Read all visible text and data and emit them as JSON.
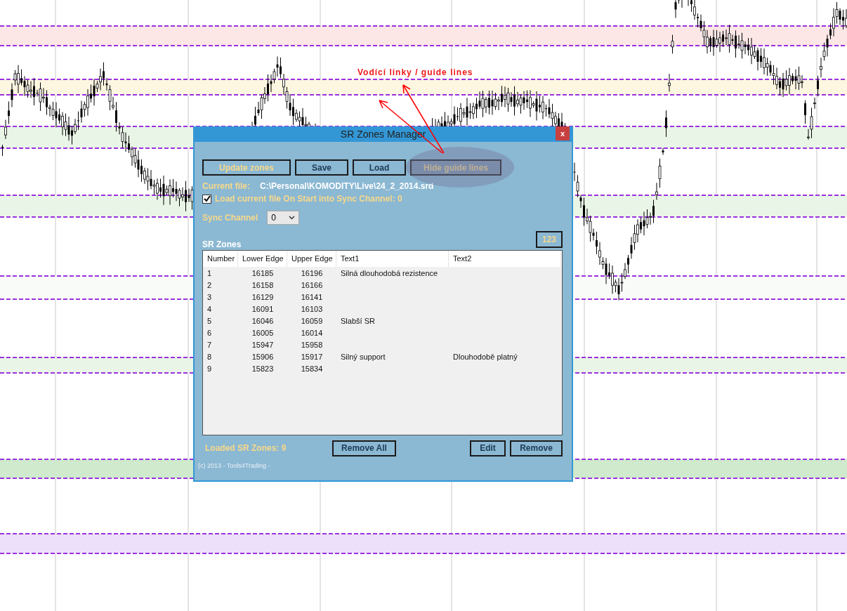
{
  "chart": {
    "annotation": "Vodící linky / guide lines"
  },
  "dialog": {
    "title": "SR Zones Manager",
    "close_glyph": "x",
    "buttons": [
      {
        "label": "Update zones",
        "kind": "accent"
      },
      {
        "label": "Save",
        "kind": "plain"
      },
      {
        "label": "Load",
        "kind": "plain"
      },
      {
        "label": "Hide guide lines",
        "kind": "accent"
      }
    ],
    "current_file_label": "Current file:",
    "current_file": "C:\\Personal\\KOMODITY\\Live\\24_2_2014.srd",
    "load_on_start": {
      "label": "Load current file On Start into Sync Channel: 0",
      "checked": true
    },
    "sync_channel": {
      "label": "Sync Channel",
      "value": "0"
    },
    "section_title": "SR Zones",
    "count": "123",
    "table": {
      "columns": [
        "Number",
        "Lower Edge",
        "Upper Edge",
        "Text1",
        "Text2"
      ],
      "rows": [
        {
          "number": "1",
          "lower": "16185",
          "upper": "16196",
          "text1": "Silná dlouhodobá rezistence"
        },
        {
          "number": "2",
          "lower": "16158",
          "upper": "16166"
        },
        {
          "number": "3",
          "lower": "16129",
          "upper": "16141"
        },
        {
          "number": "4",
          "lower": "16091",
          "upper": "16103"
        },
        {
          "number": "5",
          "lower": "16046",
          "upper": "16059",
          "text1": "Slabší SR"
        },
        {
          "number": "6",
          "lower": "16005",
          "upper": "16014"
        },
        {
          "number": "7",
          "lower": "15947",
          "upper": "15958"
        },
        {
          "number": "8",
          "lower": "15906",
          "upper": "15917",
          "text1": "Silný support",
          "text2": "Dlouhodobě platný"
        },
        {
          "number": "9",
          "lower": "15823",
          "upper": "15834"
        }
      ]
    },
    "loaded": "Loaded SR Zones: 9",
    "bottom_buttons": [
      "Remove All",
      "Edit",
      "Remove"
    ],
    "copyright": "(c) 2013 - Tools4Trading -"
  }
}
